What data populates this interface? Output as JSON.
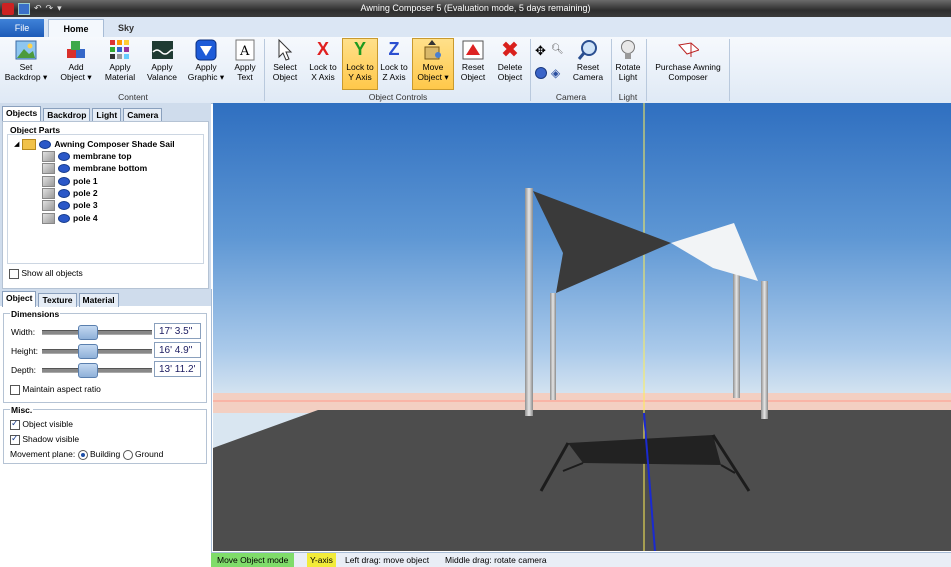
{
  "window": {
    "title": "Awning Composer 5 (Evaluation mode, 5 days remaining)"
  },
  "tabs": {
    "file": "File",
    "home": "Home",
    "sky": "Sky"
  },
  "ribbon": {
    "set_backdrop": "Set Backdrop ▾",
    "add_object": "Add Object ▾",
    "apply_material": "Apply Material",
    "apply_valance": "Apply Valance",
    "apply_graphic": "Apply Graphic ▾",
    "apply_text": "Apply Text",
    "select_object": "Select Object",
    "lock_x": "Lock to X Axis",
    "lock_y": "Lock to Y Axis",
    "lock_z": "Lock to Z Axis",
    "move_object": "Move Object ▾",
    "reset_object": "Reset Object",
    "delete_object": "Delete Object",
    "reset_camera": "Reset Camera",
    "rotate_light": "Rotate Light",
    "purchase": "Purchase Awning Composer",
    "groups": {
      "content": "Content",
      "object_controls": "Object Controls",
      "camera": "Camera",
      "light": "Light"
    }
  },
  "panel1": {
    "tabs": [
      "Objects",
      "Backdrop",
      "Light",
      "Camera"
    ],
    "group_title": "Object Parts",
    "root": "Awning Composer Shade Sail",
    "items": [
      "membrane top",
      "membrane bottom",
      "pole 1",
      "pole 2",
      "pole 3",
      "pole 4"
    ],
    "show_all": "Show all objects"
  },
  "panel2": {
    "tabs": [
      "Object",
      "Texture",
      "Material"
    ],
    "dimensions_title": "Dimensions",
    "width_label": "Width:",
    "height_label": "Height:",
    "depth_label": "Depth:",
    "width_value": "17' 3.5\"",
    "height_value": "16' 4.9\"",
    "depth_value": "13' 11.2'",
    "maintain_aspect": "Maintain aspect ratio",
    "misc_title": "Misc.",
    "object_visible": "Object visible",
    "shadow_visible": "Shadow visible",
    "movement_plane": "Movement plane:",
    "building": "Building",
    "ground": "Ground"
  },
  "status": {
    "mode": "Move Object mode",
    "axis": "Y-axis",
    "hint1": "Left drag: move object",
    "hint2": "Middle drag: rotate camera"
  },
  "colors": {
    "accent": "#1d5bb8",
    "active_button": "#ffc84a",
    "status_mode": "#7fdc6a",
    "status_axis": "#f2ec3a"
  }
}
